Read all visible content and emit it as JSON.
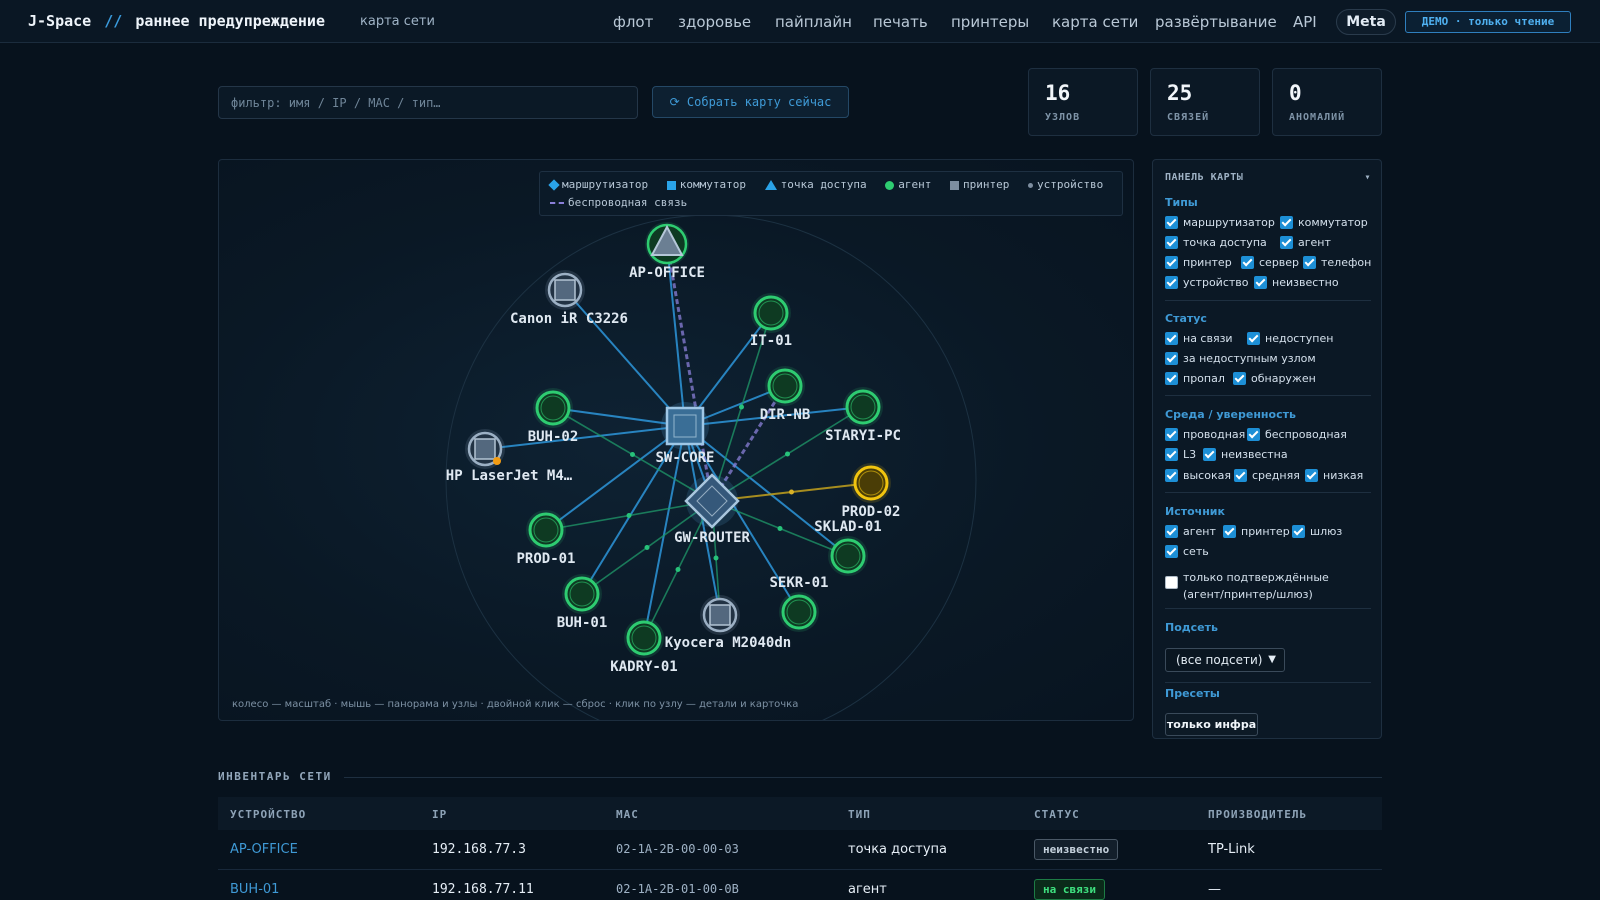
{
  "header": {
    "brand": "J-Space",
    "brand_sep": "//",
    "brand_title": "раннее предупреждение",
    "subtitle": "карта сети",
    "nav": [
      "флот",
      "здоровье",
      "пайплайн",
      "печать",
      "принтеры",
      "карта сети",
      "развёртывание",
      "API"
    ],
    "meta": "Meta",
    "demo": "ДЕМО · только чтение"
  },
  "controls": {
    "filter_placeholder": "фильтр: имя / IP / MAC / тип…",
    "collect_label": "⟳ Собрать карту сейчас"
  },
  "stats": [
    {
      "value": "16",
      "label": "УЗЛОВ"
    },
    {
      "value": "25",
      "label": "СВЯЗЕЙ"
    },
    {
      "value": "0",
      "label": "АНОМАЛИЙ"
    }
  ],
  "legend": {
    "items": [
      "маршрутизатор",
      "коммутатор",
      "точка доступа",
      "агент",
      "принтер",
      "устройство"
    ],
    "wireless": "беспроводная связь"
  },
  "map": {
    "hint": "колесо — масштаб · мышь — панорама и узлы · двойной клик — сброс · клик по узлу — детали и карточка",
    "nodes": [
      {
        "label": "AP-OFFICE",
        "kind": "ap",
        "status": "unknown"
      },
      {
        "label": "Canon iR C3226",
        "kind": "printer",
        "status": "unknown"
      },
      {
        "label": "IT-01",
        "kind": "agent",
        "status": "online"
      },
      {
        "label": "DIR-NB",
        "kind": "agent",
        "status": "online"
      },
      {
        "label": "BUH-02",
        "kind": "agent",
        "status": "online"
      },
      {
        "label": "STARYI-PC",
        "kind": "agent",
        "status": "online"
      },
      {
        "label": "HP LaserJet M4…",
        "kind": "printer",
        "status": "unknown"
      },
      {
        "label": "SW-CORE",
        "kind": "switch",
        "status": "unknown"
      },
      {
        "label": "PROD-02",
        "kind": "agent",
        "status": "warning"
      },
      {
        "label": "GW-ROUTER",
        "kind": "router",
        "status": "unknown"
      },
      {
        "label": "SKLAD-01",
        "kind": "agent",
        "status": "online"
      },
      {
        "label": "PROD-01",
        "kind": "agent",
        "status": "online"
      },
      {
        "label": "SEKR-01",
        "kind": "agent",
        "status": "online"
      },
      {
        "label": "BUH-01",
        "kind": "agent",
        "status": "online"
      },
      {
        "label": "Kyocera M2040dn",
        "kind": "printer",
        "status": "unknown"
      },
      {
        "label": "KADRY-01",
        "kind": "agent",
        "status": "online"
      }
    ]
  },
  "side": {
    "title": "ПАНЕЛЬ КАРТЫ",
    "types_title": "Типы",
    "types": [
      "маршрутизатор",
      "коммутатор",
      "точка доступа",
      "агент",
      "принтер",
      "сервер",
      "телефон",
      "устройство",
      "неизвестно"
    ],
    "status_title": "Статус",
    "statuses": [
      "на связи",
      "недоступен",
      "за недоступным узлом",
      "пропал",
      "обнаружен"
    ],
    "env_title": "Среда / уверенность",
    "env": [
      "проводная",
      "беспроводная",
      "L3",
      "неизвестна",
      "высокая",
      "средняя",
      "низкая"
    ],
    "source_title": "Источник",
    "sources": [
      "агент",
      "принтер",
      "шлюз",
      "сеть"
    ],
    "confirmed_only": "только подтверждённые",
    "confirmed_only_2": "(агент/принтер/шлюз)",
    "subnet_title": "Подсеть",
    "subnet_value": "(все подсети)",
    "presets_title": "Пресеты",
    "preset": "только инфра"
  },
  "inventory": {
    "title": "ИНВЕНТАРЬ СЕТИ",
    "columns": [
      "УСТРОЙСТВО",
      "IP",
      "MAC",
      "ТИП",
      "СТАТУС",
      "ПРОИЗВОДИТЕЛЬ"
    ],
    "rows": [
      {
        "device": "AP-OFFICE",
        "ip": "192.168.77.3",
        "mac": "02-1A-2B-00-00-03",
        "type": "точка доступа",
        "status": "неизвестно",
        "vendor": "TP-Link"
      },
      {
        "device": "BUH-01",
        "ip": "192.168.77.11",
        "mac": "02-1A-2B-01-00-0B",
        "type": "агент",
        "status": "на связи",
        "vendor": "—"
      }
    ]
  },
  "colors": {
    "accent": "#3a9bdc",
    "online": "#2ecc71",
    "warning": "#f1c40f",
    "link": "#2b8fd0"
  }
}
